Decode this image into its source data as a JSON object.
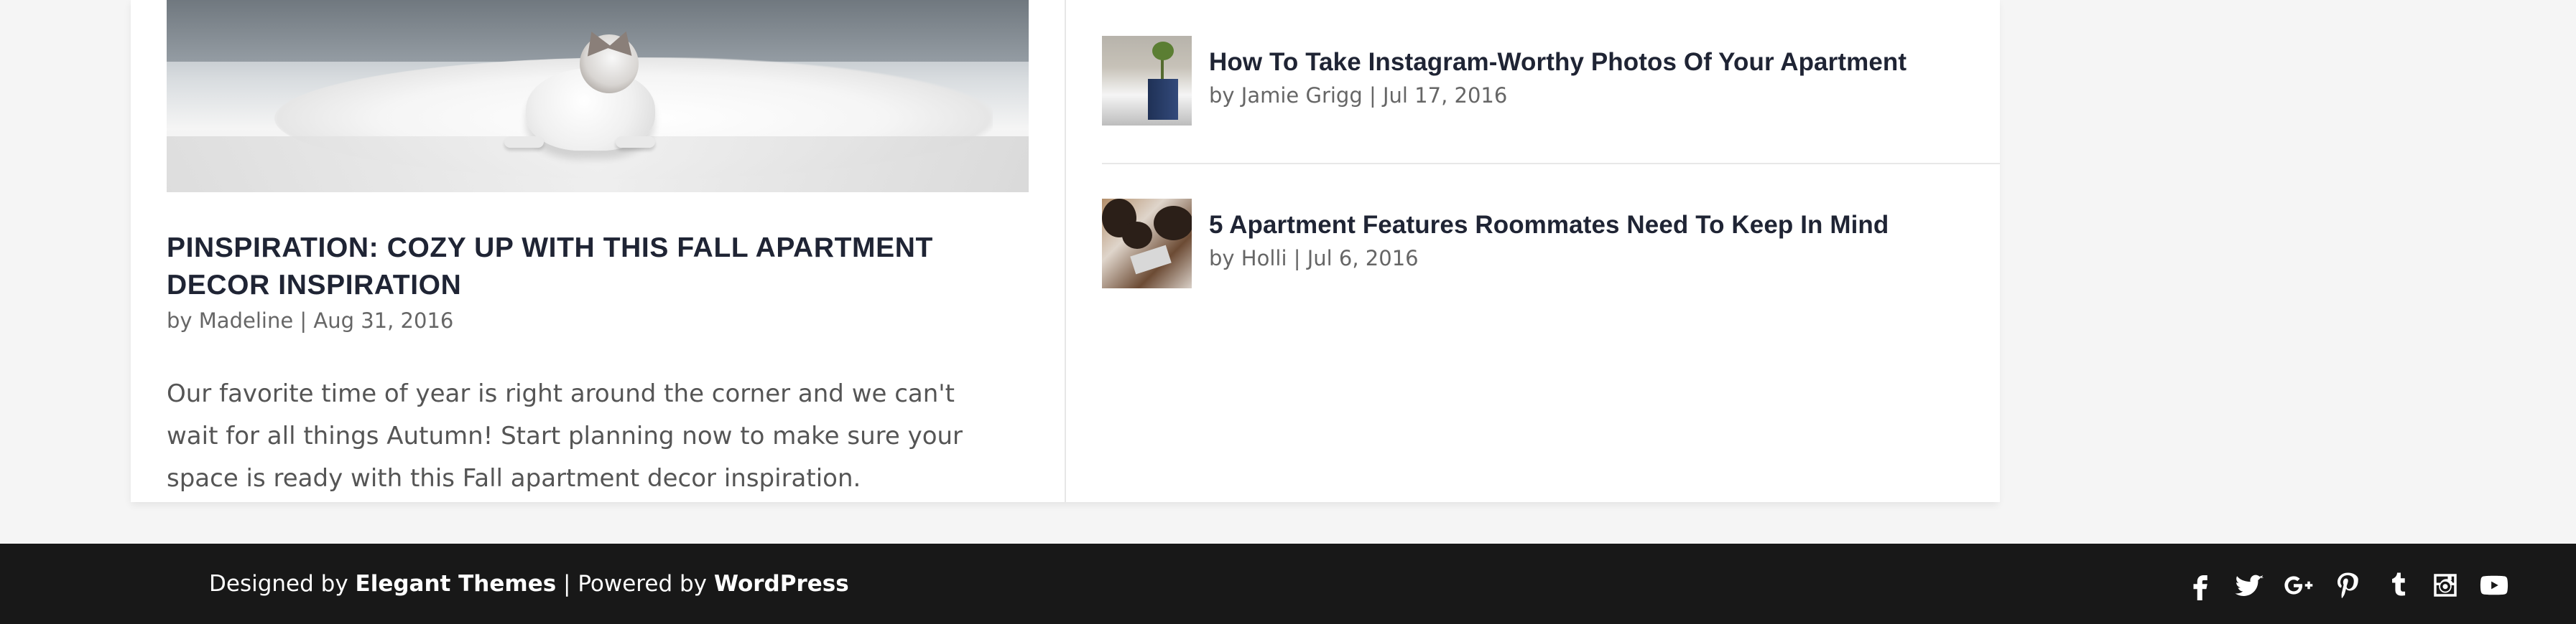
{
  "featured_post": {
    "title": "PINSPIRATION: COZY UP WITH THIS FALL APARTMENT DECOR INSPIRATION",
    "meta": "by Madeline | Aug 31, 2016",
    "excerpt": "Our favorite time of year is right around the corner and we can't wait for all things Autumn! Start planning now to make sure your space is ready with this Fall apartment decor inspiration."
  },
  "related_posts": [
    {
      "title": "How To Take Instagram-Worthy Photos Of Your Apartment",
      "meta": "by Jamie Grigg | Jul 17, 2016"
    },
    {
      "title": "5 Apartment Features Roommates Need To Keep In Mind",
      "meta": "by Holli | Jul 6, 2016"
    }
  ],
  "footer": {
    "designed_by_prefix": "Designed by",
    "designer_link": "Elegant Themes",
    "separator": "| Powered by",
    "platform_link": "WordPress"
  },
  "social_icons": [
    "facebook-icon",
    "twitter-icon",
    "google-plus-icon",
    "pinterest-icon",
    "tumblr-icon",
    "instagram-icon",
    "youtube-icon"
  ],
  "colors": {
    "background": "#f5f5f5",
    "card": "#ffffff",
    "footer": "#181818",
    "heading": "#1f2434",
    "text": "#555555",
    "meta": "#666666"
  }
}
